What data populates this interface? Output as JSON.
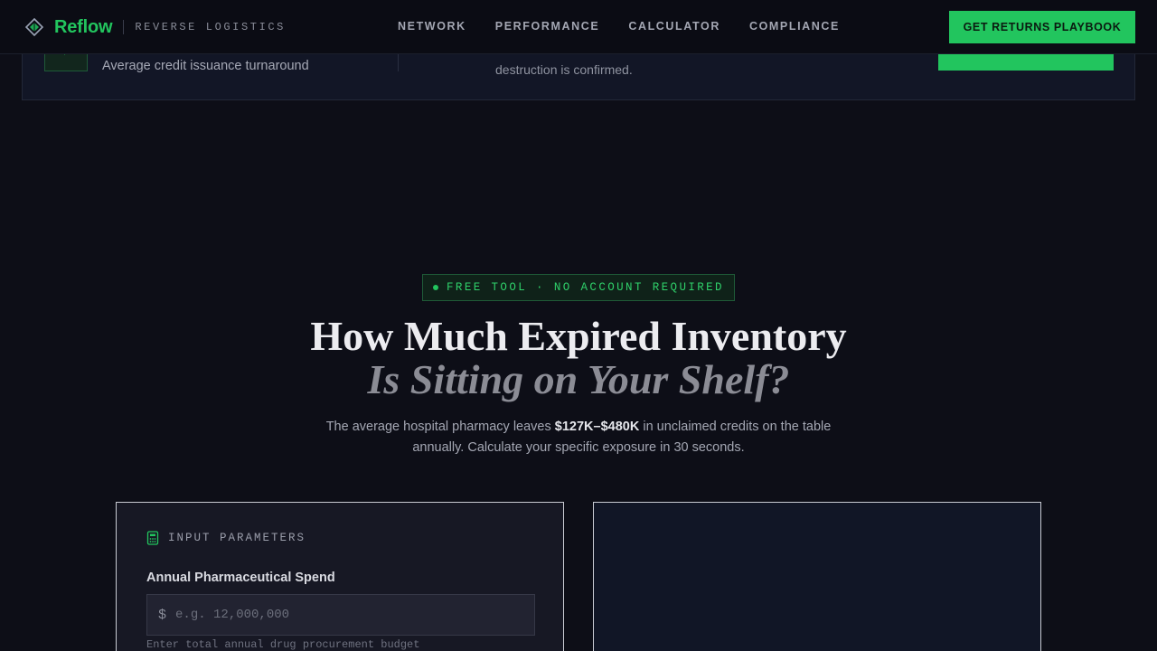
{
  "brand": {
    "name": "Reflow",
    "tagline": "REVERSE LOGISTICS",
    "icon": "diamond-logo-icon"
  },
  "nav": {
    "links": [
      "NETWORK",
      "PERFORMANCE",
      "CALCULATOR",
      "COMPLIANCE"
    ],
    "cta_label": "GET RETURNS PLAYBOOK"
  },
  "stats_strip": {
    "stat_label": "Average credit issuance turnaround",
    "note_text": "destruction is confirmed.",
    "icon": "arrow-icon"
  },
  "hero": {
    "badge": "FREE TOOL · NO ACCOUNT REQUIRED",
    "title_line1": "How Much Expired Inventory",
    "title_line2": "Is Sitting on Your Shelf?",
    "sub_before": "The average hospital pharmacy leaves ",
    "sub_highlight": "$127K–$480K",
    "sub_after": " in unclaimed credits on the table annually. Calculate your specific exposure in 30 seconds."
  },
  "calculator": {
    "panel_title": "INPUT PARAMETERS",
    "panel_icon": "calculator-icon",
    "field_label": "Annual Pharmaceutical Spend",
    "field_prefix": "$",
    "field_placeholder": "e.g. 12,000,000",
    "field_hint": "Enter total annual drug procurement budget"
  },
  "colors": {
    "accent": "#22c55e",
    "background": "#0d0e17",
    "panel": "#171824"
  }
}
